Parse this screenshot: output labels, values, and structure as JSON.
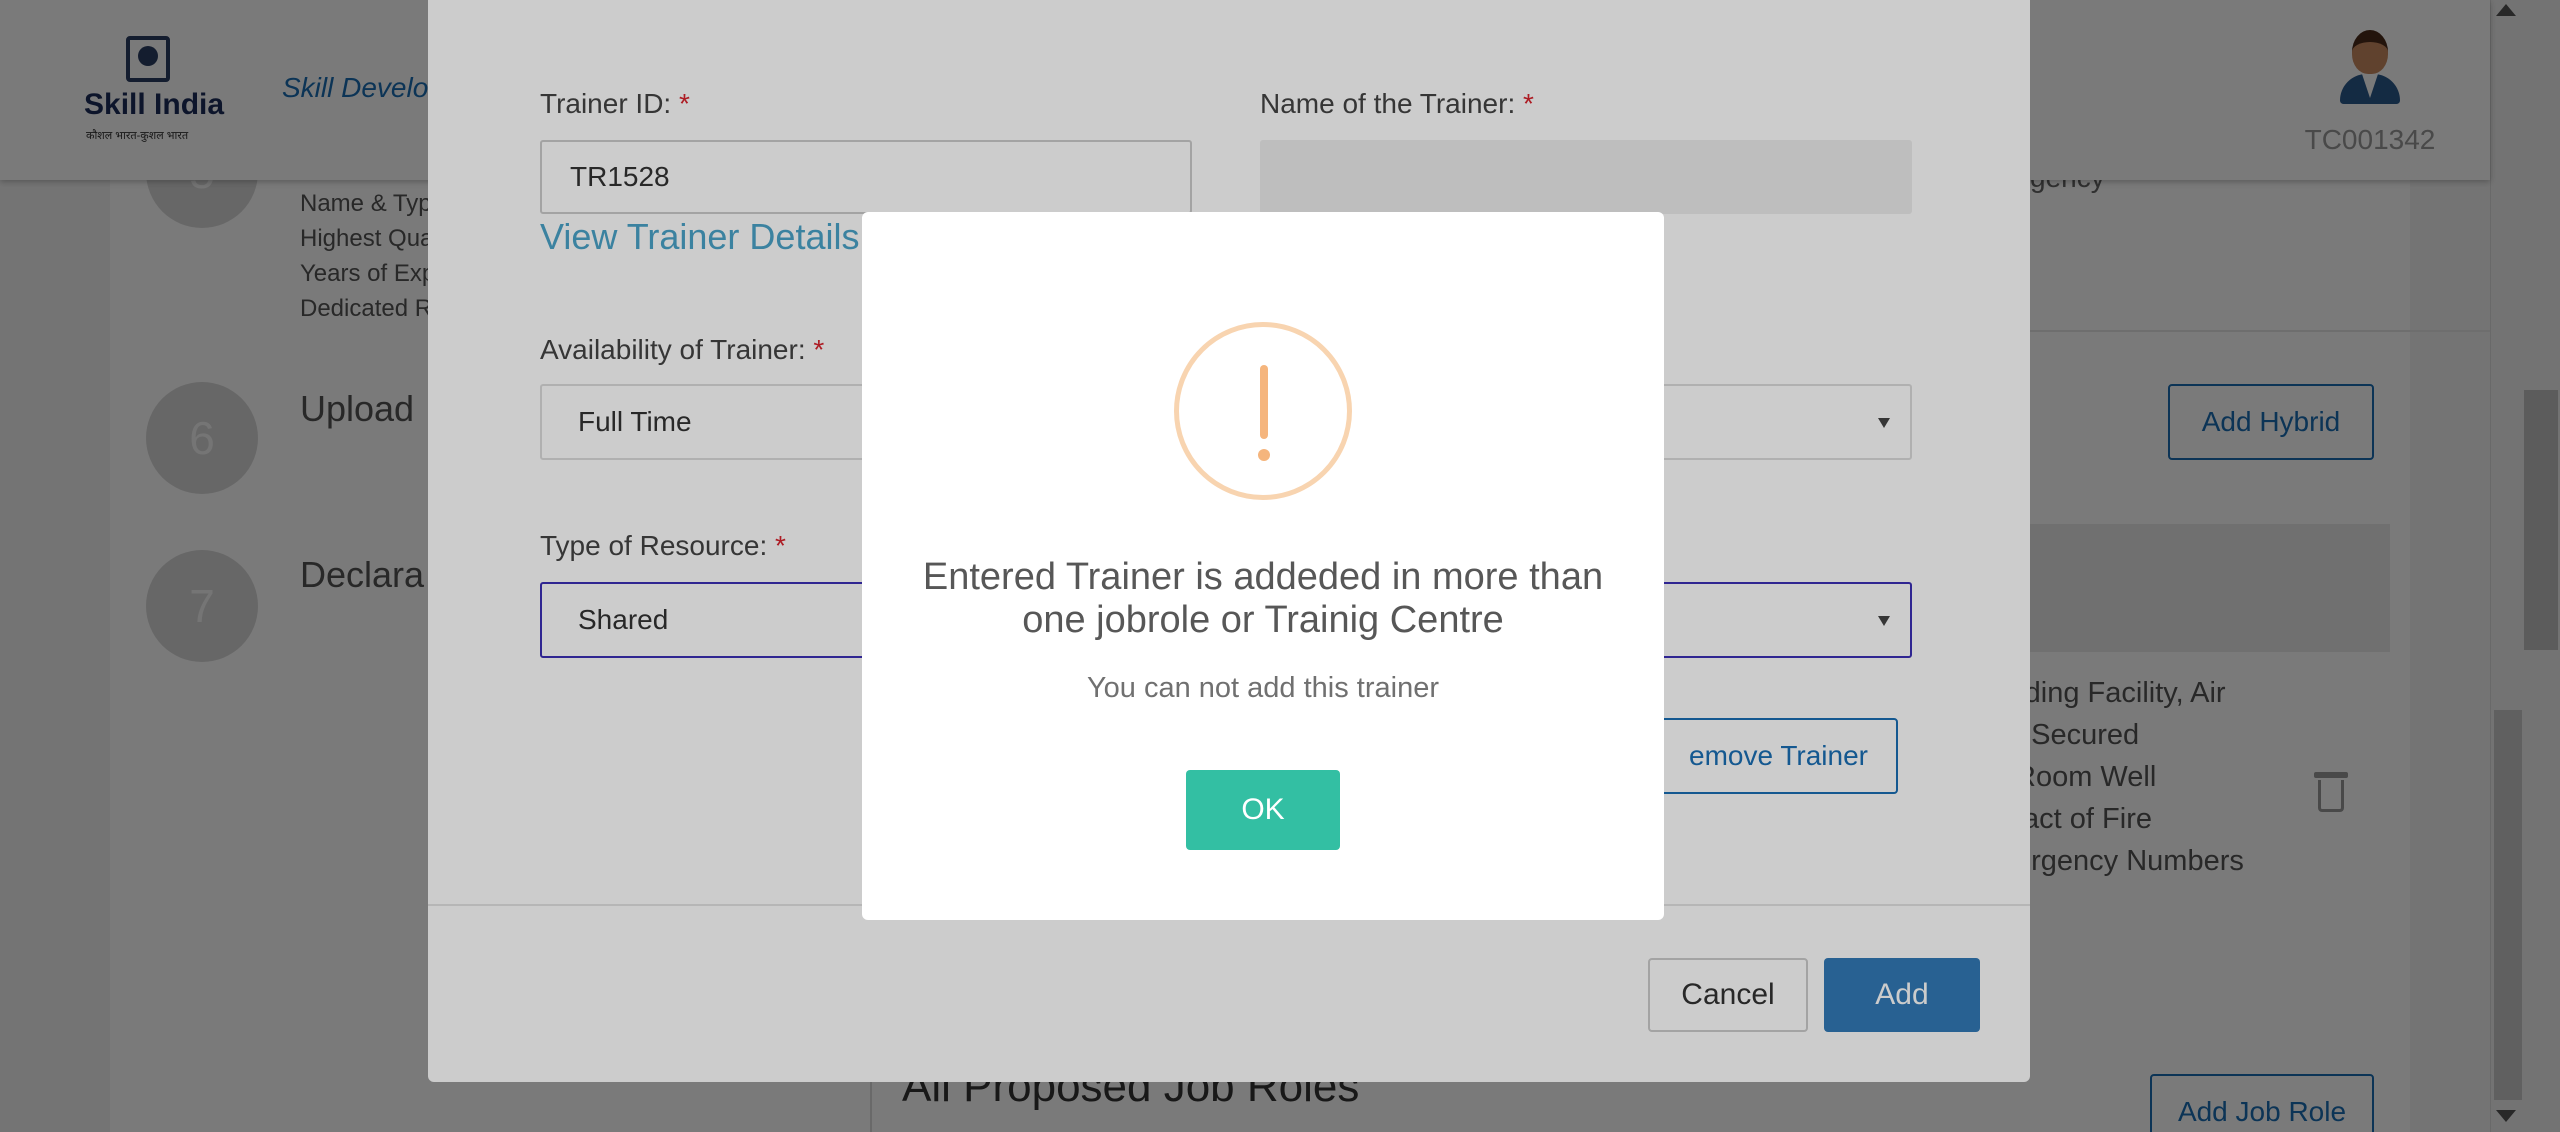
{
  "header": {
    "logo_text": "Skill India",
    "logo_tagline": "कौशल भारत-कुशल भारत",
    "brand_title": "Skill Develo",
    "user_id": "TC001342"
  },
  "background": {
    "steps": [
      {
        "number": "5",
        "title": "",
        "lines": [
          "Name & Typ",
          "Highest Qua",
          "Years of Exp",
          "Dedicated R"
        ]
      },
      {
        "number": "6",
        "title": "Upload"
      },
      {
        "number": "7",
        "title": "Declara"
      }
    ],
    "right_fragment_top": "gency",
    "add_hybrid_label": "Add Hybrid",
    "facility_lines": [
      "rding Facility, Air",
      ", Secured",
      "Room Well",
      "tact of Fire",
      "ergency Numbers"
    ],
    "proposed_title": "All Proposed Job Roles",
    "add_job_role_label": "Add Job Role"
  },
  "modal": {
    "trainer_id_label": "Trainer ID:",
    "trainer_id_value": "TR1528",
    "trainer_name_label": "Name of the Trainer:",
    "trainer_name_value": "",
    "view_details_label": "View Trainer Details",
    "availability_label": "Availability of Trainer:",
    "availability_value": "Full Time",
    "resource_label": "Type of Resource:",
    "resource_value": "Shared",
    "remove_trainer_label": "emove Trainer",
    "required_marker": "*",
    "cancel_label": "Cancel",
    "add_label": "Add"
  },
  "alert": {
    "icon": "exclamation-icon",
    "title": "Entered Trainer is addeded in more than one jobrole or Trainig Centre",
    "text": "You can not add this trainer",
    "ok_label": "OK",
    "colors": {
      "icon": "#f5b57d",
      "ok_button": "#33bfa3"
    }
  },
  "colors": {
    "brand_blue": "#1a6fb5",
    "required": "#d9232d",
    "primary_button": "#337ab7"
  }
}
